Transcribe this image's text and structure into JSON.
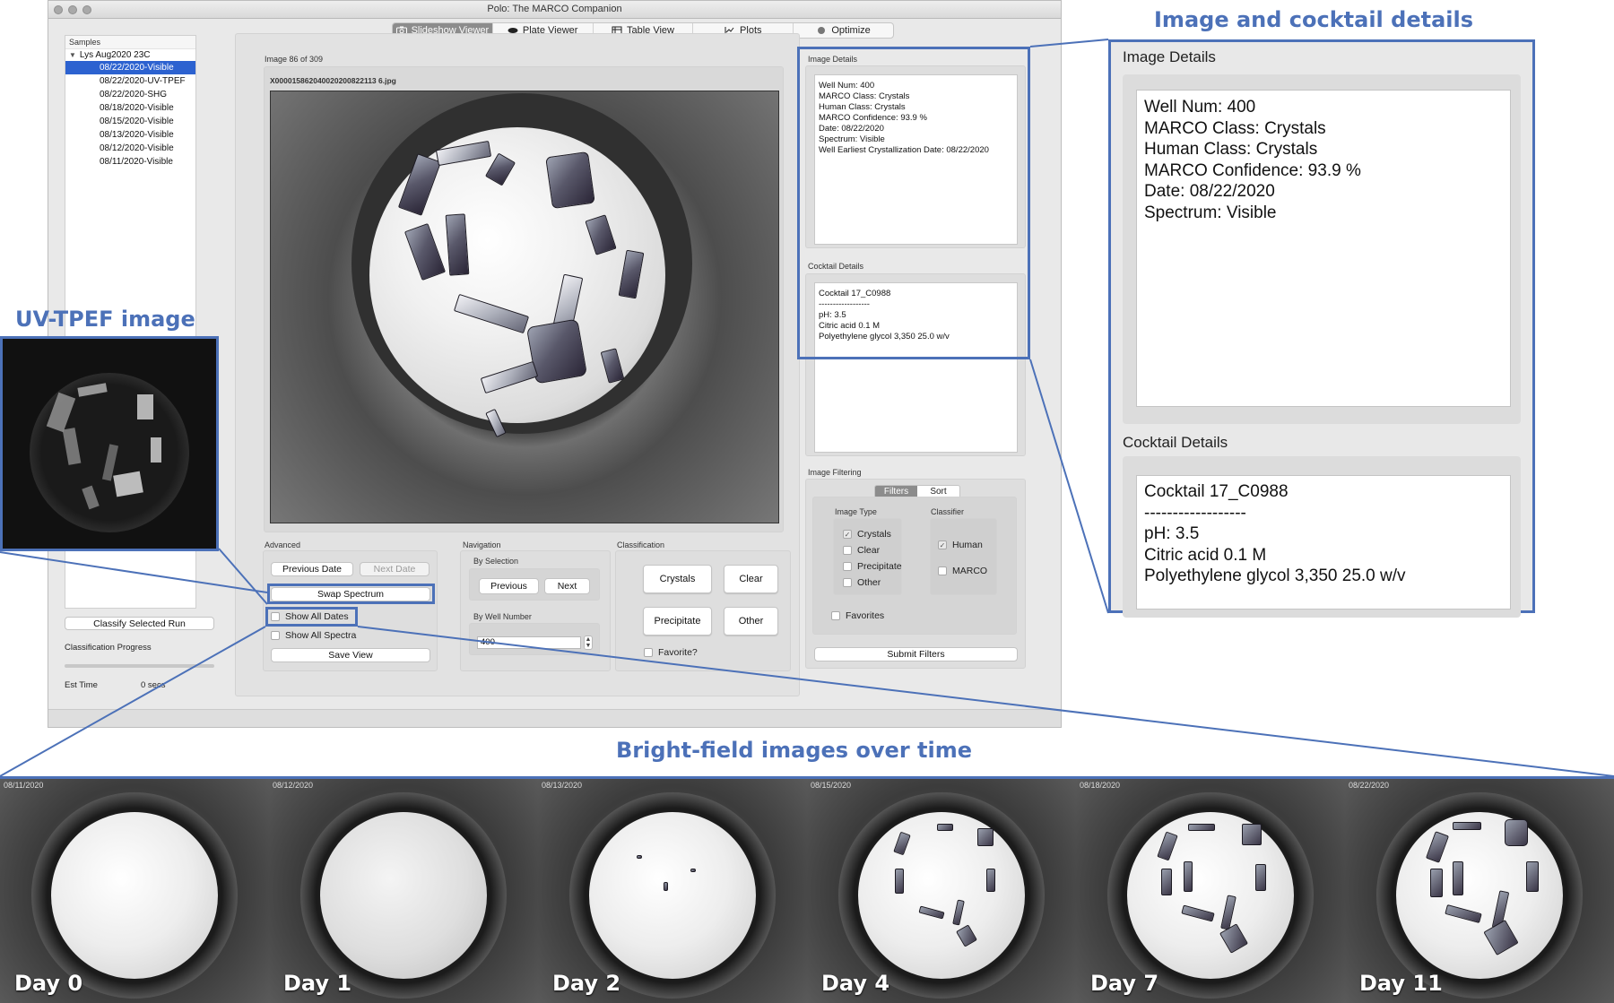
{
  "window": {
    "title": "Polo: The MARCO Companion"
  },
  "tabs": [
    {
      "label": "Slideshow Viewer",
      "icon": "camera-icon",
      "active": true
    },
    {
      "label": "Plate Viewer",
      "icon": "plate-icon",
      "active": false
    },
    {
      "label": "Table View",
      "icon": "table-icon",
      "active": false
    },
    {
      "label": "Plots",
      "icon": "chart-icon",
      "active": false
    },
    {
      "label": "Optimize",
      "icon": "gear-icon",
      "active": false
    }
  ],
  "sidebar": {
    "header": "Samples",
    "parent": "Lys Aug2020 23C",
    "items": [
      {
        "label": "08/22/2020-Visible",
        "selected": true
      },
      {
        "label": "08/22/2020-UV-TPEF"
      },
      {
        "label": "08/22/2020-SHG"
      },
      {
        "label": "08/18/2020-Visible"
      },
      {
        "label": "08/15/2020-Visible"
      },
      {
        "label": "08/13/2020-Visible"
      },
      {
        "label": "08/12/2020-Visible"
      },
      {
        "label": "08/11/2020-Visible"
      }
    ],
    "classify_button": "Classify Selected Run",
    "progress_label": "Classification Progress",
    "progress_value": 0,
    "est_time_label": "Est Time",
    "est_time_value": "0 secs"
  },
  "viewer": {
    "counter": "Image 86 of 309",
    "filename": "X000015862040020200822113 6.jpg"
  },
  "advanced": {
    "label": "Advanced",
    "previous_date": "Previous Date",
    "next_date": "Next Date",
    "swap_spectrum": "Swap Spectrum",
    "show_all_dates": "Show All Dates",
    "show_all_spectra": "Show All Spectra",
    "save_view": "Save View"
  },
  "navigation": {
    "label": "Navigation",
    "by_selection": "By Selection",
    "previous": "Previous",
    "next": "Next",
    "by_well_number": "By Well Number",
    "well_number": "400"
  },
  "classification": {
    "label": "Classification",
    "crystals": "Crystals",
    "clear": "Clear",
    "precipitate": "Precipitate",
    "other": "Other",
    "favorite": "Favorite?"
  },
  "image_details": {
    "label": "Image Details",
    "text": "Well Num: 400\nMARCO Class: Crystals\nHuman Class: Crystals\nMARCO Confidence: 93.9 %\nDate: 08/22/2020\nSpectrum: Visible\nWell Earliest Crystallization Date: 08/22/2020"
  },
  "cocktail_details": {
    "label": "Cocktail Details",
    "text": "Cocktail 17_C0988\n------------------\npH: 3.5\nCitric acid  0.1 M\nPolyethylene glycol 3,350 25.0 w/v"
  },
  "filtering": {
    "label": "Image Filtering",
    "tab_filters": "Filters",
    "tab_sort": "Sort",
    "image_type_label": "Image Type",
    "classifier_label": "Classifier",
    "types": [
      {
        "label": "Crystals",
        "checked": true
      },
      {
        "label": "Clear",
        "checked": false
      },
      {
        "label": "Precipitate",
        "checked": false
      },
      {
        "label": "Other",
        "checked": false
      }
    ],
    "classifiers": [
      {
        "label": "Human",
        "checked": true
      },
      {
        "label": "MARCO",
        "checked": false
      }
    ],
    "favorites": "Favorites",
    "submit": "Submit Filters"
  },
  "callouts": {
    "details_title": "Image and cocktail details",
    "uv_title": "UV-TPEF image",
    "brightfield_title": "Bright-field images over time"
  },
  "zoom": {
    "image_details_label": "Image Details",
    "image_details_text": "Well Num: 400\nMARCO Class: Crystals\nHuman Class: Crystals\nMARCO Confidence: 93.9 %\nDate: 08/22/2020\nSpectrum: Visible",
    "cocktail_label": "Cocktail Details",
    "cocktail_text": "Cocktail 17_C0988\n------------------\npH: 3.5\nCitric acid  0.1 M\nPolyethylene glycol 3,350 25.0 w/v"
  },
  "timeline": [
    {
      "date": "08/11/2020",
      "day": "Day 0"
    },
    {
      "date": "08/12/2020",
      "day": "Day 1"
    },
    {
      "date": "08/13/2020",
      "day": "Day 2"
    },
    {
      "date": "08/15/2020",
      "day": "Day 4"
    },
    {
      "date": "08/18/2020",
      "day": "Day 7"
    },
    {
      "date": "08/22/2020",
      "day": "Day 11"
    }
  ],
  "colors": {
    "accent": "#4c71b8",
    "selection": "#2c62d0"
  }
}
